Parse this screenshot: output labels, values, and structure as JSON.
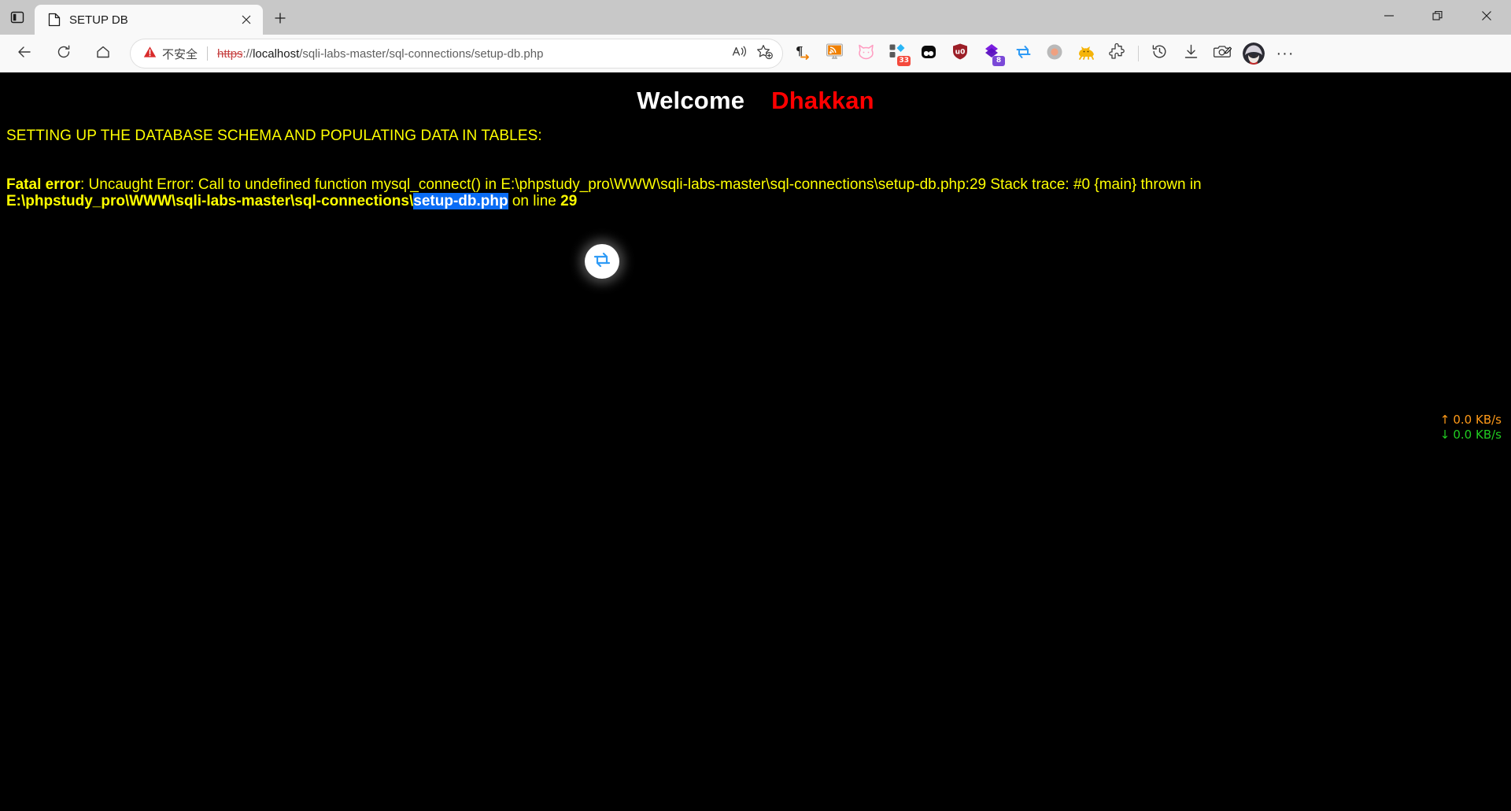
{
  "window": {
    "controls": [
      {
        "name": "minimize",
        "glyph": "minimize-icon"
      },
      {
        "name": "restore",
        "glyph": "restore-icon"
      },
      {
        "name": "close",
        "glyph": "close-icon"
      }
    ]
  },
  "tabstrip": {
    "tab_actions_label": "tab-actions-icon",
    "tabs": [
      {
        "title": "SETUP DB",
        "favicon": "page-icon",
        "close_label": "×"
      }
    ],
    "new_tab_label": "+"
  },
  "toolbar": {
    "back_label": "back-icon",
    "refresh_label": "refresh-icon",
    "home_label": "home-icon",
    "read_aloud_label": "read-aloud-icon",
    "add_favorite_label": "add-favorite-icon",
    "more_label": "···"
  },
  "omnibox": {
    "security_text": "不安全",
    "url_scheme": "https",
    "url_separator": "://",
    "url_host": "localhost",
    "url_path": "/sqli-labs-master/sql-connections/setup-db.php",
    "full_url": "https://localhost/sqli-labs-master/sql-connections/setup-db.php",
    "placeholder": "Search or enter web address"
  },
  "extensions": [
    {
      "name": "pilcrow-arrow-icon",
      "badge": ""
    },
    {
      "name": "rss-feed-reader-icon",
      "badge": ""
    },
    {
      "name": "pink-cat-icon",
      "badge": ""
    },
    {
      "name": "blocks-extension-icon",
      "badge": "33"
    },
    {
      "name": "two-dots-extension-icon",
      "badge": ""
    },
    {
      "name": "ublock-shield-icon",
      "badge": ""
    },
    {
      "name": "purple-diamonds-icon",
      "badge": "8"
    },
    {
      "name": "swap-arrows-icon",
      "badge": ""
    },
    {
      "name": "grey-circle-icon",
      "badge": ""
    },
    {
      "name": "yellow-cat-icon",
      "badge": ""
    },
    {
      "name": "puzzle-extensions-icon",
      "badge": ""
    }
  ],
  "toolbar_right": [
    {
      "name": "history-icon"
    },
    {
      "name": "downloads-icon"
    },
    {
      "name": "screenshot-capture-icon"
    },
    {
      "name": "profile-avatar"
    },
    {
      "name": "settings-more-icon"
    }
  ],
  "page": {
    "welcome_white": "Welcome",
    "welcome_red": "Dhakkan",
    "schema_heading": "SETTING UP THE DATABASE SCHEMA AND POPULATING DATA IN TABLES:",
    "error": {
      "label": "Fatal error",
      "part1": ": Uncaught Error: Call to undefined function mysql_connect() in E:\\phpstudy_pro\\WWW\\sqli-labs-master\\sql-connections\\setup-db.php:29 Stack trace: #0 {main} thrown in ",
      "path_bold": "E:\\phpstudy_pro\\WWW\\sqli-labs-master\\sql-connections\\",
      "path_selected": "setup-db.php",
      "part2": " on line ",
      "line_number": "29"
    },
    "float_button": "swap-arrows-floating-icon",
    "network": {
      "upload_arrow": "↑",
      "upload_value": "0.0 KB/s",
      "download_arrow": "↓",
      "download_value": "0.0 KB/s"
    },
    "colors": {
      "background": "#000000",
      "text_yellow": "#ffff00",
      "accent_red": "#ff0000",
      "selection_blue": "#0a6cf5",
      "upload": "#ff9a18",
      "download": "#21cc21"
    }
  }
}
